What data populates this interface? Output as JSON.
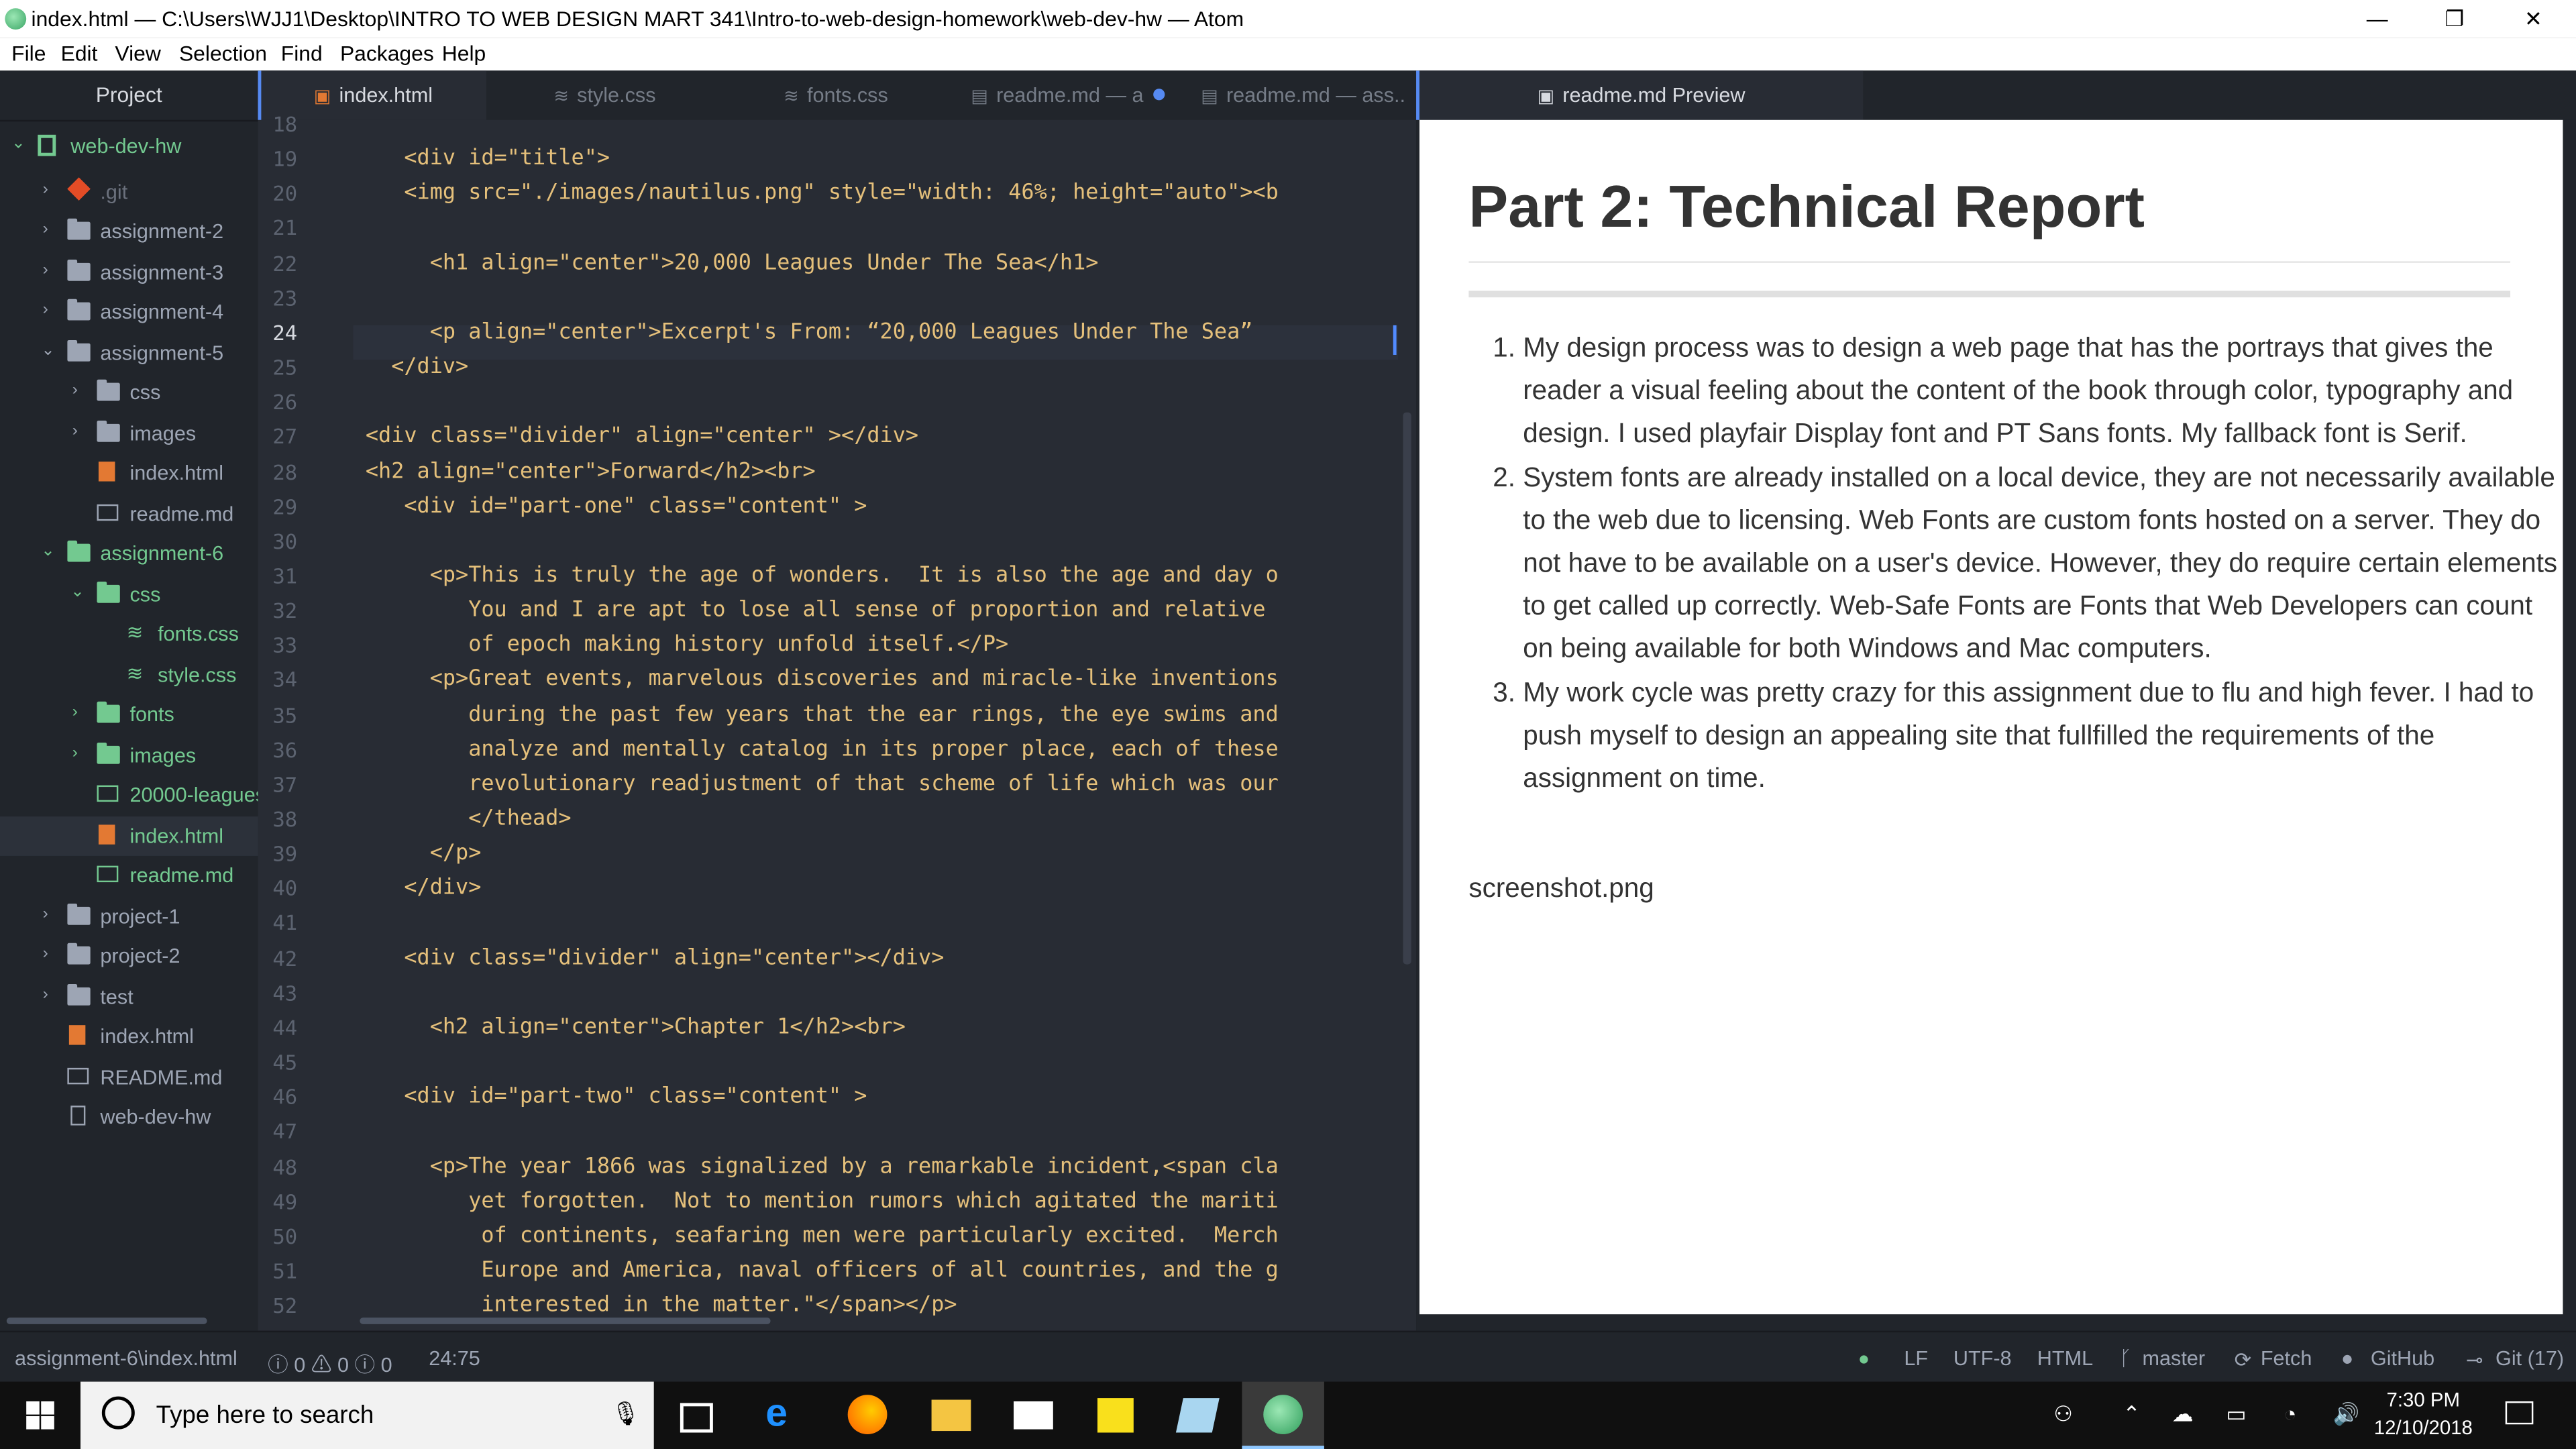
{
  "window": {
    "title": "index.html — C:\\Users\\WJJ1\\Desktop\\INTRO TO WEB DESIGN MART 341\\Intro-to-web-design-homework\\web-dev-hw — Atom",
    "minimize": "—",
    "restore": "❐",
    "close": "✕"
  },
  "menu": [
    "File",
    "Edit",
    "View",
    "Selection",
    "Find",
    "Packages",
    "Help"
  ],
  "sidebar": {
    "header": "Project",
    "items": [
      {
        "label": "web-dev-hw",
        "kind": "repo"
      },
      {
        "label": ".git",
        "kind": "git"
      },
      {
        "label": "assignment-2",
        "kind": "folder"
      },
      {
        "label": "assignment-3",
        "kind": "folder"
      },
      {
        "label": "assignment-4",
        "kind": "folder"
      },
      {
        "label": "assignment-5",
        "kind": "folder"
      },
      {
        "label": "css",
        "kind": "folder"
      },
      {
        "label": "images",
        "kind": "folder"
      },
      {
        "label": "index.html",
        "kind": "html"
      },
      {
        "label": "readme.md",
        "kind": "md"
      },
      {
        "label": "assignment-6",
        "kind": "folder"
      },
      {
        "label": "css",
        "kind": "folder"
      },
      {
        "label": "fonts.css",
        "kind": "css"
      },
      {
        "label": "style.css",
        "kind": "css"
      },
      {
        "label": "fonts",
        "kind": "folder"
      },
      {
        "label": "images",
        "kind": "folder"
      },
      {
        "label": "20000-leagues",
        "kind": "md"
      },
      {
        "label": "index.html",
        "kind": "html"
      },
      {
        "label": "readme.md",
        "kind": "md"
      },
      {
        "label": "project-1",
        "kind": "folder"
      },
      {
        "label": "project-2",
        "kind": "folder"
      },
      {
        "label": "test",
        "kind": "folder"
      },
      {
        "label": "index.html",
        "kind": "html"
      },
      {
        "label": "README.md",
        "kind": "md"
      },
      {
        "label": "web-dev-hw",
        "kind": "file"
      }
    ]
  },
  "tabs": [
    "index.html",
    "style.css",
    "fonts.css",
    "readme.md — a",
    "readme.md — ass.."
  ],
  "editor": {
    "line_numbers": [
      "18",
      "19",
      "20",
      "21",
      "22",
      "23",
      "24",
      "25",
      "26",
      "27",
      "28",
      "29",
      "30",
      "31",
      "32",
      "33",
      "34",
      "35",
      "36",
      "37",
      "38",
      "39",
      "40",
      "41",
      "42",
      "43",
      "44",
      "45",
      "46",
      "47",
      "48",
      "49",
      "50",
      "51",
      "52"
    ],
    "lines": [
      "",
      "      <div id=\"title\">",
      "      <img src=\"./images/nautilus.png\" style=\"width: 46%; height=\"auto\"><b",
      "",
      "        <h1 align=\"center\">20,000 Leagues Under The Sea</h1>",
      "",
      "        <p align=\"center\">Excerpt's From: “20,000 Leagues Under The Sea”",
      "     </div>",
      "",
      "   <div class=\"divider\" align=\"center\" ></div>",
      "   <h2 align=\"center\">Forward</h2><br>",
      "      <div id=\"part-one\" class=\"content\" >",
      "",
      "        <p>This is truly the age of wonders.  It is also the age and day o",
      "           You and I are apt to lose all sense of proportion and relative ",
      "           of epoch making history unfold itself.</P>",
      "        <p>Great events, marvelous discoveries and miracle-like inventions",
      "           during the past few years that the ear rings, the eye swims and",
      "           analyze and mentally catalog in its proper place, each of these",
      "           revolutionary readjustment of that scheme of life which was our",
      "           </thead>",
      "        </p>",
      "      </div>",
      "",
      "      <div class=\"divider\" align=\"center\"></div>",
      "",
      "        <h2 align=\"center\">Chapter 1</h2><br>",
      "",
      "      <div id=\"part-two\" class=\"content\" >",
      "",
      "        <p>The year 1866 was signalized by a remarkable incident,<span cla",
      "           yet forgotten.  Not to mention rumors which agitated the mariti",
      "            of continents, seafaring men were particularly excited.  Merch",
      "            Europe and America, naval officers of all countries, and the g",
      "            interested in the matter.\"</span></p>"
    ]
  },
  "preview": {
    "tab": "readme.md Preview",
    "heading": "Part 2: Technical Report",
    "items": [
      "My design process was to design a web page that has the portrays that gives the reader a visual feeling about the content of the book through color, typography and design. I used playfair Display font and PT Sans fonts. My fallback font is Serif.",
      "System fonts are already installed on a local device, they are not necessarily available to the web due to licensing. Web Fonts are custom fonts hosted on a server. They do not have to be available on a user's device. However, they do require certain elements to get called up correctly. Web-Safe Fonts are Fonts that Web Developers can count on being available for both Windows and Mac computers.",
      "My work cycle was pretty crazy for this assignment due to flu and high fever. I had to push myself to design an appealing site that fullfilled the requirements of the assignment on time."
    ],
    "footer_text": "screenshot.png"
  },
  "status": {
    "path": "assignment-6\\index.html",
    "diagnostics": "ⓘ 0 ⚠ 0 ⓘ 0",
    "cursor": "24:75",
    "line_ending": "LF",
    "encoding": "UTF-8",
    "grammar": "HTML",
    "branch": "master",
    "fetch": "Fetch",
    "github": "GitHub",
    "git": "Git (17)"
  },
  "taskbar": {
    "search_placeholder": "Type here to search",
    "time": "7:30 PM",
    "date": "12/10/2018"
  }
}
